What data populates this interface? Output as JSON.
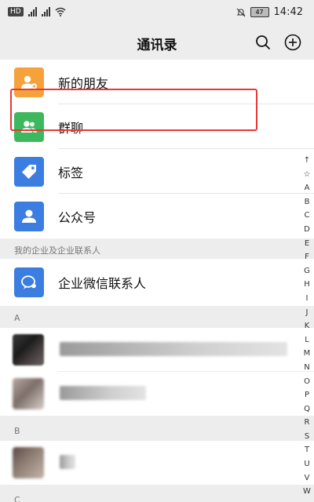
{
  "status_bar": {
    "hd": "HD",
    "battery": "47",
    "time": "14:42"
  },
  "header": {
    "title": "通讯录",
    "icons": [
      "search-icon",
      "add-icon"
    ]
  },
  "menu": {
    "items": [
      {
        "label": "新的朋友",
        "icon": "add-friend-icon",
        "color": "#f5a23d"
      },
      {
        "label": "群聊",
        "icon": "group-icon",
        "color": "#3db85e"
      },
      {
        "label": "标签",
        "icon": "tag-icon",
        "color": "#3b7de0"
      },
      {
        "label": "公众号",
        "icon": "official-account-icon",
        "color": "#3b7de0"
      }
    ]
  },
  "sections": {
    "enterprise_header": "我的企业及企业联系人",
    "enterprise_item": {
      "label": "企业微信联系人",
      "icon": "enterprise-chat-icon",
      "color": "#3b7de0"
    },
    "a_header": "A",
    "b_header": "B",
    "c_header": "C"
  },
  "index_bar": [
    "↑",
    "☆",
    "A",
    "B",
    "C",
    "D",
    "E",
    "F",
    "G",
    "H",
    "I",
    "J",
    "K",
    "L",
    "M",
    "N",
    "O",
    "P",
    "Q",
    "R",
    "S",
    "T",
    "U",
    "V",
    "W"
  ],
  "colors": {
    "highlight": "#e53935",
    "background": "#ededed"
  }
}
